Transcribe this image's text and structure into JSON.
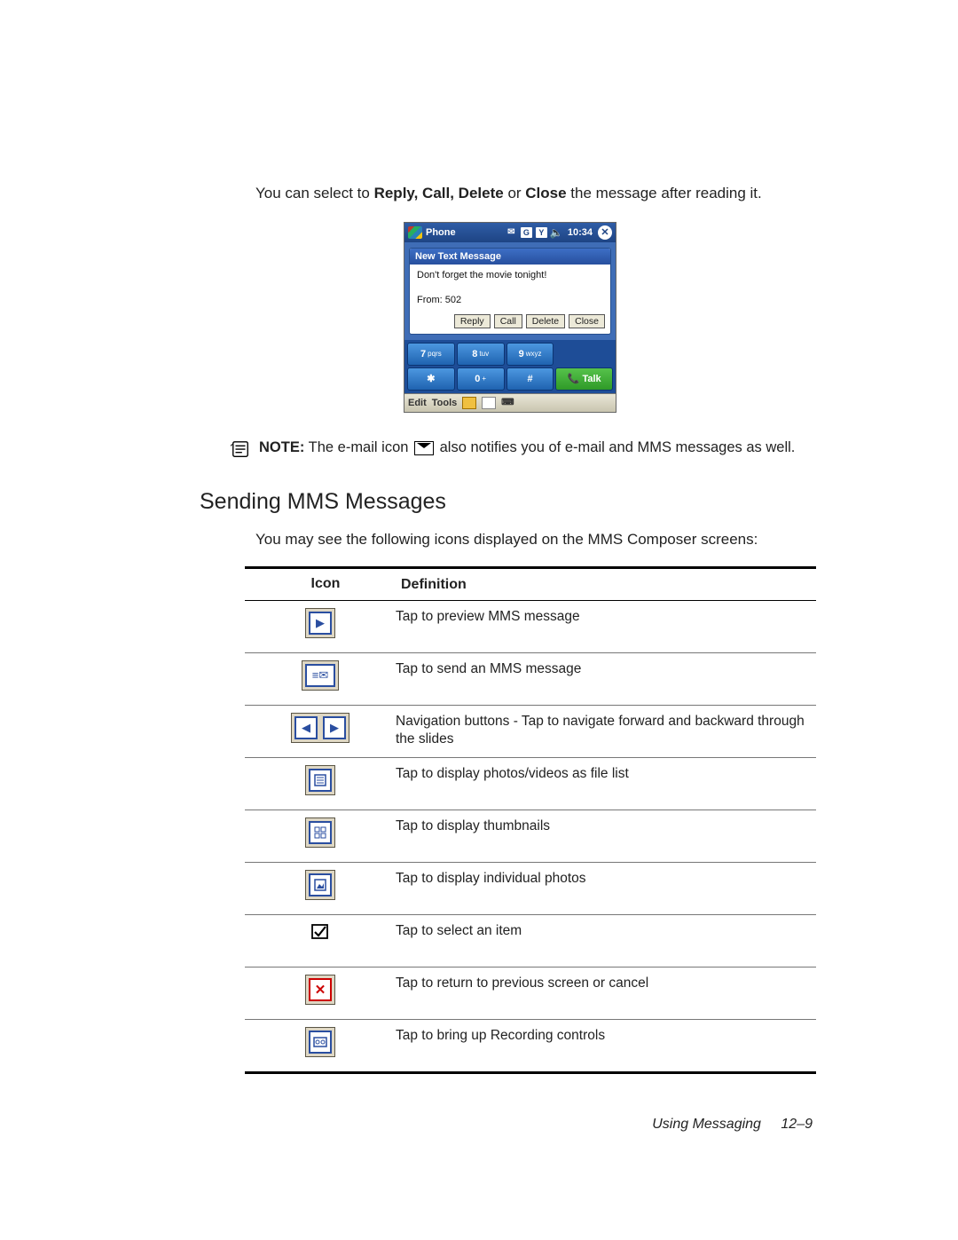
{
  "intro": {
    "pre": "You can select to ",
    "bold1": "Reply, Call, Delete",
    "mid": " or ",
    "bold2": "Close",
    "post": " the message after reading it."
  },
  "phone": {
    "app_title": "Phone",
    "status": {
      "g": "G",
      "y": "Y",
      "time": "10:34"
    },
    "bubble_title": "New Text Message",
    "message": "Don't forget the movie tonight!",
    "from_label": "From:",
    "from_value": "502",
    "buttons": {
      "reply": "Reply",
      "call": "Call",
      "delete": "Delete",
      "close": "Close"
    },
    "keys": {
      "k7": "7",
      "k7s": "pqrs",
      "k8": "8",
      "k8s": "tuv",
      "k9": "9",
      "k9s": "wxyz",
      "star": "✱",
      "k0": "0",
      "k0s": "+",
      "hash": "#",
      "talk": "Talk"
    },
    "bottombar": {
      "edit": "Edit",
      "tools": "Tools"
    }
  },
  "note": {
    "label": "NOTE:",
    "text1": " The e-mail icon ",
    "text2": " also notifies you of e-mail and MMS messages as well."
  },
  "section_heading": "Sending MMS Messages",
  "section_intro": "You may see the following icons displayed on the MMS Composer screens:",
  "table": {
    "head_icon": "Icon",
    "head_def": "Definition",
    "rows": [
      {
        "def": "Tap to preview MMS message"
      },
      {
        "def": "Tap to send an MMS message"
      },
      {
        "def": "Navigation buttons - Tap to navigate forward and backward through the slides"
      },
      {
        "def": "Tap to display photos/videos as file list"
      },
      {
        "def": "Tap to display thumbnails"
      },
      {
        "def": "Tap to display individual photos"
      },
      {
        "def": "Tap to select an item"
      },
      {
        "def": "Tap to return to previous screen or cancel"
      },
      {
        "def": "Tap to bring up Recording controls"
      }
    ]
  },
  "footer": {
    "chapter": "Using Messaging",
    "page": "12–9"
  }
}
